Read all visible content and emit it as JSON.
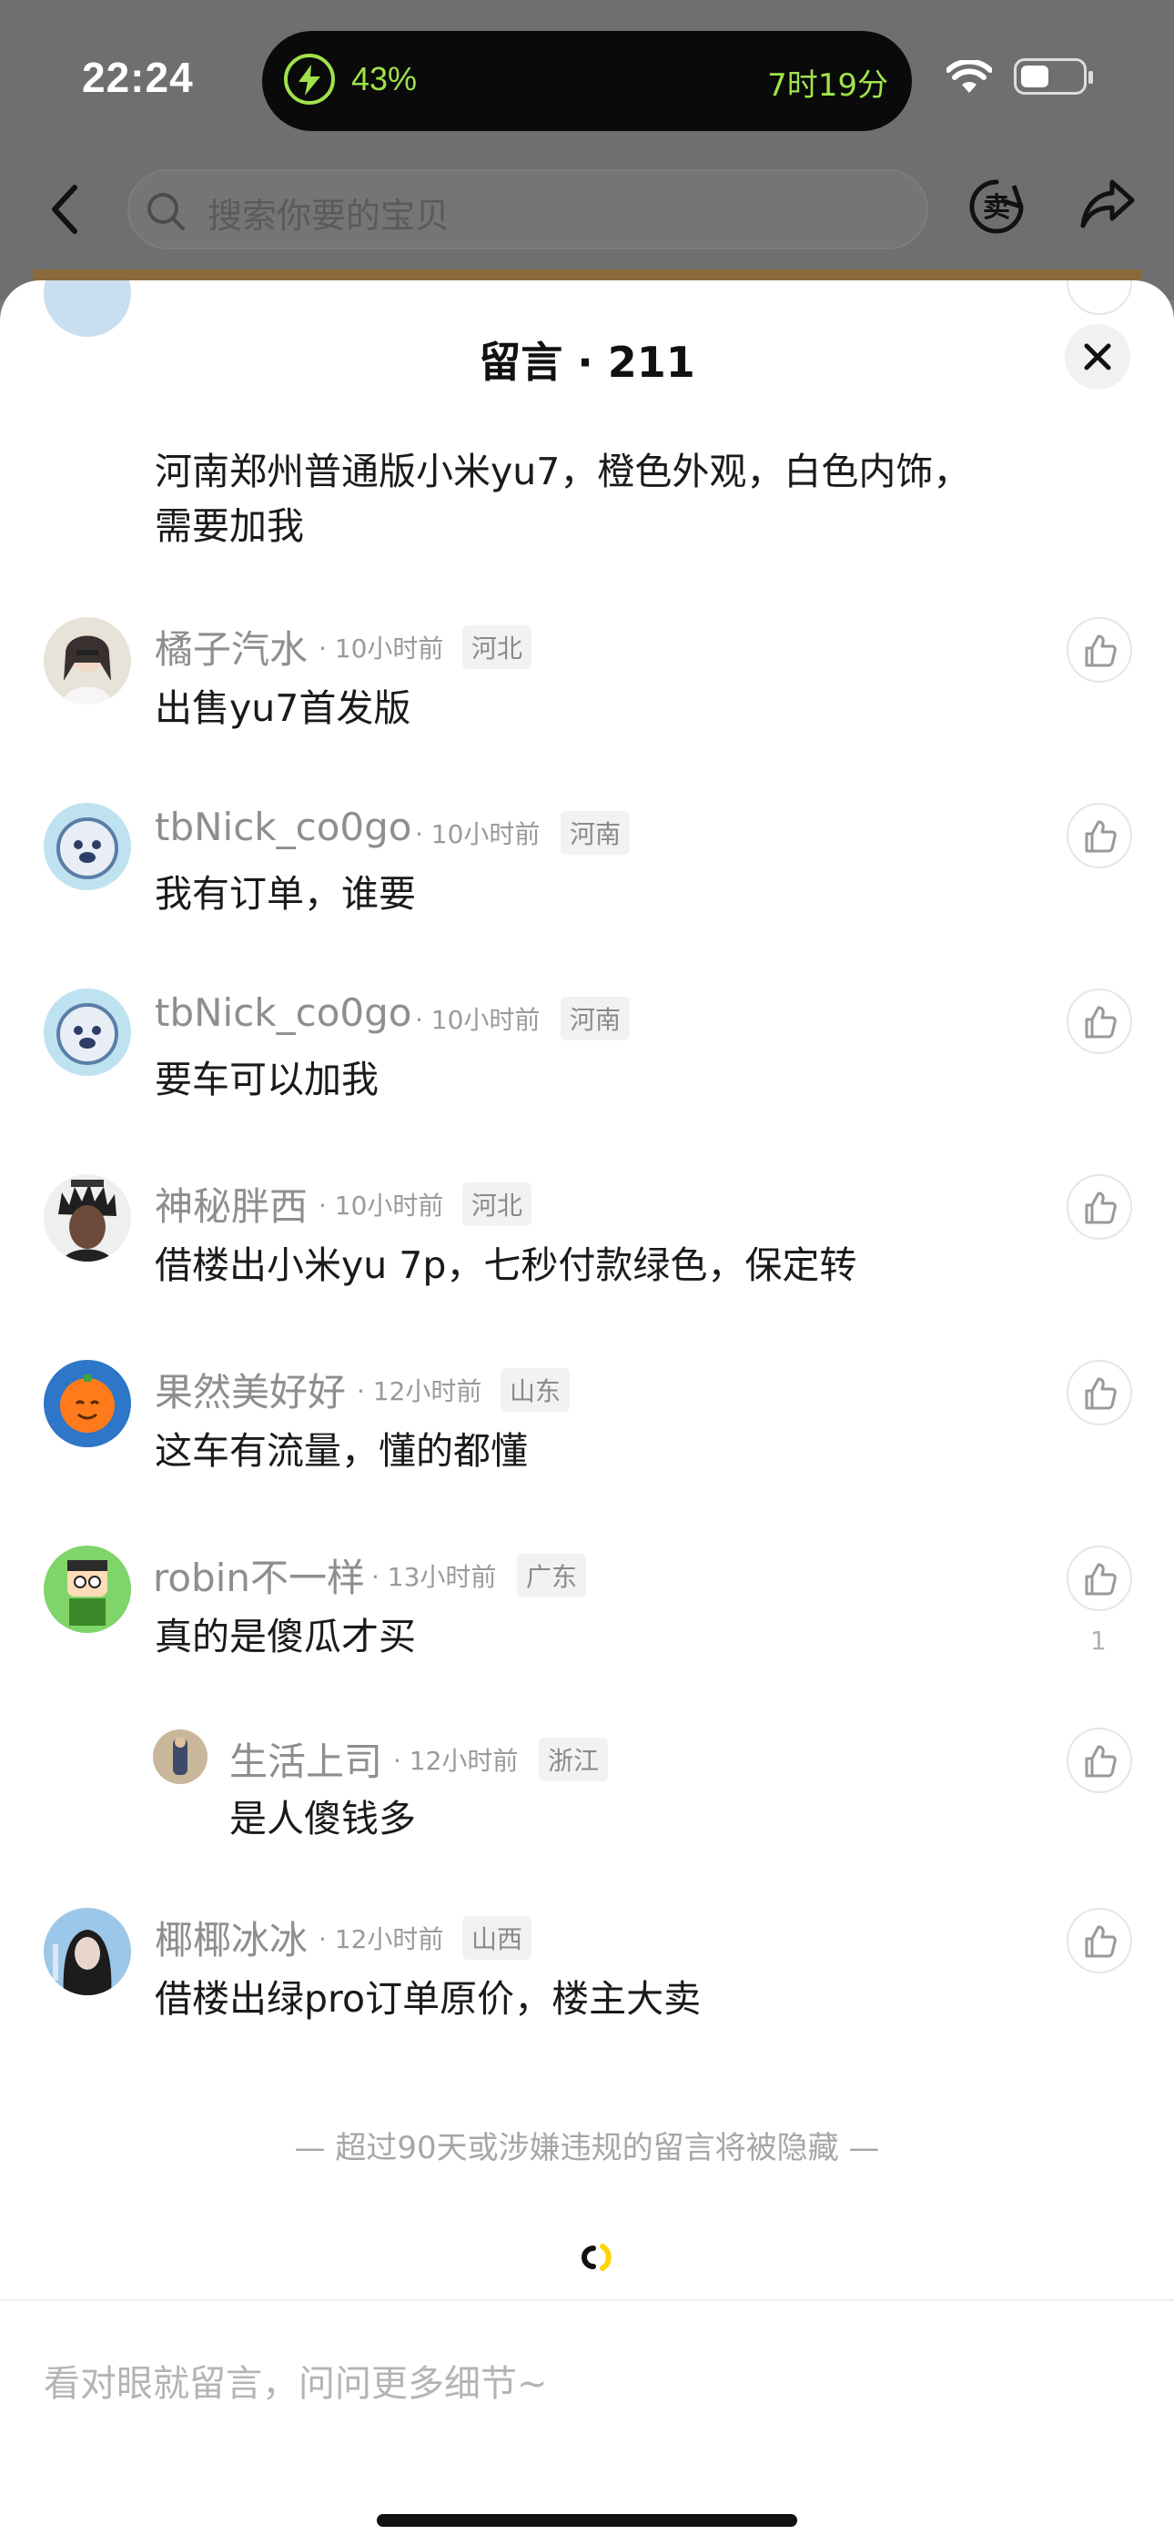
{
  "status_bar": {
    "time": "22:24",
    "battery_pct": "43%",
    "remaining": "7时19分"
  },
  "top_bar": {
    "search_placeholder": "搜索你要的宝贝",
    "sell_icon_text": "卖"
  },
  "sheet": {
    "title": "留言 · 211",
    "close_label": "×"
  },
  "comments": [
    {
      "content": "河南郑州普通版小米yu7，橙色外观，白色内饰，",
      "content2": "需要加我"
    },
    {
      "name": "橘子汽水",
      "time": "· 10小时前",
      "loc": "河北",
      "content": "出售yu7首发版"
    },
    {
      "name": "tbNick_co0go",
      "time": "· 10小时前",
      "loc": "河南",
      "content": "我有订单，谁要"
    },
    {
      "name": "tbNick_co0go",
      "time": "· 10小时前",
      "loc": "河南",
      "content": "要车可以加我"
    },
    {
      "name": "神秘胖西",
      "time": "· 10小时前",
      "loc": "河北",
      "content": "借楼出小米yu 7p，七秒付款绿色，保定转"
    },
    {
      "name": "果然美好好",
      "time": "· 12小时前",
      "loc": "山东",
      "content": "这车有流量，懂的都懂"
    },
    {
      "name": "robin不一样",
      "time": "· 13小时前",
      "loc": "广东",
      "content": "真的是傻瓜才买",
      "likes": "1"
    },
    {
      "name": "生活上司",
      "time": "· 12小时前",
      "loc": "浙江",
      "content": "是人傻钱多"
    },
    {
      "name": "椰椰冰冰",
      "time": "· 12小时前",
      "loc": "山西",
      "content": "借楼出绿pro订单原价，楼主大卖"
    }
  ],
  "footer_note": "— 超过90天或涉嫌违规的留言将被隐藏 —",
  "input": {
    "placeholder": "看对眼就留言，问问更多细节~"
  },
  "colors": {
    "battery_green": "#9fe34b",
    "name_gray": "#8e8e8e",
    "accent_yellow": "#ffd400"
  }
}
